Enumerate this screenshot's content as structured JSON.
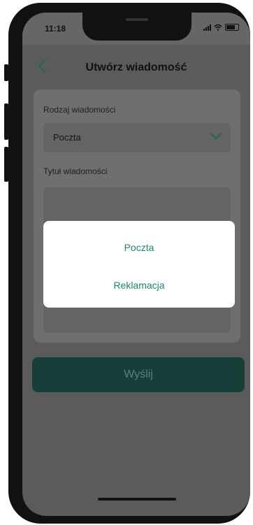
{
  "status_bar": {
    "time": "11:18"
  },
  "header": {
    "title": "Utwórz wiadomość",
    "back_icon": "chevron-left-icon"
  },
  "form": {
    "message_type_label": "Rodzaj wiadomości",
    "message_type_value": "Poczta",
    "message_title_label": "Tytuł wiadomości"
  },
  "send_button": {
    "label": "Wyślij"
  },
  "modal": {
    "options": [
      "Poczta",
      "Reklamacja"
    ]
  },
  "colors": {
    "accent": "#1a8a6a",
    "button": "#173f39"
  }
}
